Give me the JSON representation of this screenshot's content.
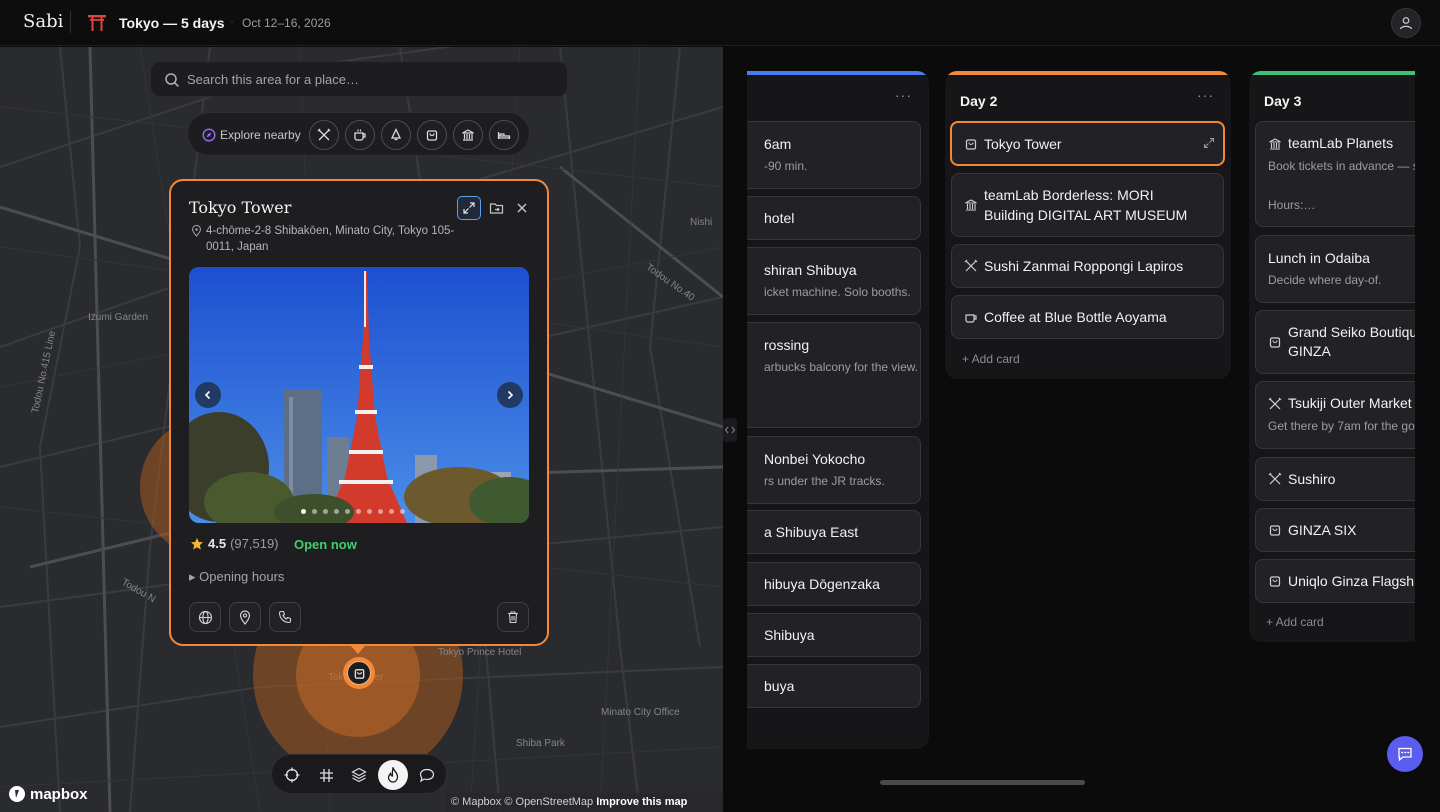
{
  "header": {
    "brand": "Sabi",
    "trip_title": "Tokyo — 5 days",
    "separator": "·",
    "dates": "Oct 12–16, 2026",
    "avatar_icon": "user-icon"
  },
  "map": {
    "search_placeholder": "Search this area for a place…",
    "explore_label": "Explore nearby",
    "categories": [
      "restaurant-icon",
      "coffee-icon",
      "bell-icon",
      "shopping-bag-icon",
      "museum-icon",
      "bed-icon"
    ],
    "labels": {
      "izumi_garden": "Izumi Garden",
      "todou_415": "Todou No.415 Line",
      "todou_40": "Todou No.40",
      "todou_n": "Todou N",
      "nishi": "Nishi",
      "tokyo_prince": "Tokyo Prince Hotel",
      "minato_office": "Minato City Office",
      "shiba_park": "Shiba Park",
      "tokyo_tower_ghost": "Tokyo Tower"
    },
    "toolbar": [
      "crosshair-icon",
      "grid-icon",
      "layers-icon",
      "flame-icon",
      "speech-bubble-icon"
    ],
    "toolbar_active": "flame-icon",
    "logo": "mapbox",
    "attribution": "© Mapbox © OpenStreetMap",
    "improve": "Improve this map"
  },
  "popup": {
    "title": "Tokyo Tower",
    "address": "4-chōme-2-8 Shibakōen, Minato City, Tokyo 105-0011, Japan",
    "rating": "4.5",
    "rating_count": "(97,519)",
    "status": "Open now",
    "hours_label": "▸ Opening hours",
    "photo_count": 10,
    "photo_index": 1
  },
  "board": {
    "columns": [
      {
        "title": "",
        "color": "#4a7bf0",
        "cards": [
          {
            "title": "6am",
            "sub": "-90 min."
          },
          {
            "title": "hotel",
            "sub": ""
          },
          {
            "title": "shiran Shibuya",
            "sub": "icket machine. Solo booths."
          },
          {
            "title": "rossing",
            "sub": "arbucks balcony for the view."
          },
          {
            "title": "Nonbei Yokocho",
            "sub": "rs under the JR tracks."
          },
          {
            "title": "a Shibuya East",
            "sub": ""
          },
          {
            "title": "hibuya Dōgenzaka",
            "sub": ""
          },
          {
            "title": "Shibuya",
            "sub": ""
          },
          {
            "title": "buya",
            "sub": ""
          }
        ]
      },
      {
        "title": "Day 2",
        "color": "#f08a3a",
        "cards": [
          {
            "title": "Tokyo Tower",
            "icon": "shopping-bag-icon"
          },
          {
            "title": "teamLab Borderless: MORI",
            "title2": "Building DIGITAL ART MUSEUM",
            "icon": "museum-icon"
          },
          {
            "title": "Sushi Zanmai Roppongi Lapiros",
            "icon": "restaurant-icon"
          },
          {
            "title": "Coffee at Blue Bottle Aoyama",
            "icon": "coffee-icon"
          }
        ],
        "add_label": "+ Add card"
      },
      {
        "title": "Day 3",
        "color": "#3fbf7a",
        "cards": [
          {
            "title": "teamLab Planets",
            "sub": "Book tickets in advance — s",
            "sub2": "Hours:…",
            "icon": "museum-icon"
          },
          {
            "title": "Lunch in Odaiba",
            "sub": "Decide where day-of."
          },
          {
            "title": "Grand Seiko Boutique",
            "title2": "GINZA",
            "icon": "shopping-bag-icon"
          },
          {
            "title": "Tsukiji Outer Market",
            "sub": "Get there by 7am for the go",
            "icon": "restaurant-icon"
          },
          {
            "title": "Sushiro",
            "icon": "restaurant-icon"
          },
          {
            "title": "GINZA SIX",
            "icon": "shopping-bag-icon"
          },
          {
            "title": "Uniqlo Ginza Flagsh",
            "icon": "shopping-bag-icon"
          }
        ],
        "add_label": "+ Add card"
      }
    ]
  },
  "colors": {
    "accent": "#f08a3a",
    "open_green": "#3fcf6c",
    "fab": "#5b5cf0"
  }
}
